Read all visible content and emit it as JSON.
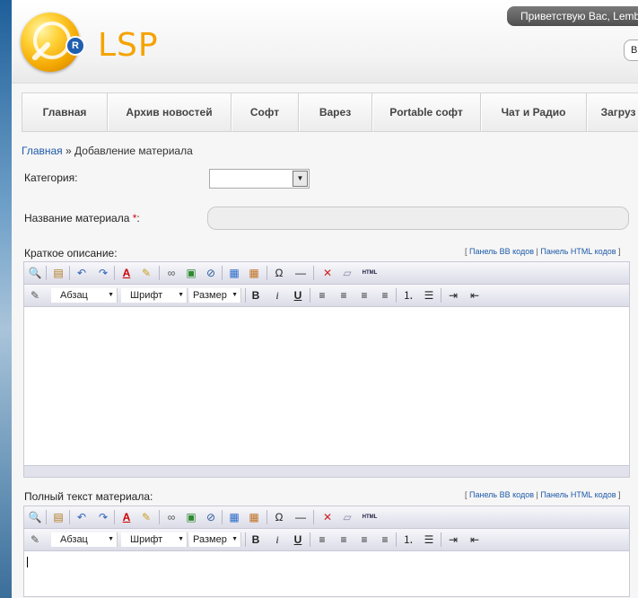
{
  "header": {
    "logo_text": "LSP",
    "logo_badge": "R",
    "welcome": "Приветствую Вас, Lemb",
    "header_button": "В"
  },
  "nav": {
    "items": [
      {
        "label": "Главная"
      },
      {
        "label": "Архив новостей"
      },
      {
        "label": "Софт"
      },
      {
        "label": "Варез"
      },
      {
        "label": "Portable софт"
      },
      {
        "label": "Чат и Радио"
      },
      {
        "label": "Загруз"
      }
    ]
  },
  "breadcrumb": {
    "home": "Главная",
    "sep": " » ",
    "current": "Добавление материала"
  },
  "form": {
    "category_label": "Категория:",
    "category_value": "",
    "title_label": "Название материала ",
    "title_required": "*",
    "title_colon": ":",
    "short_label": "Краткое описание:",
    "full_label": "Полный текст материала:",
    "panels": {
      "open": "[ ",
      "bb": "Панель BB кодов",
      "sep": " | ",
      "html": "Панель HTML кодов",
      "close": " ]"
    }
  },
  "toolbar": {
    "paragraph": "Абзац",
    "font": "Шрифт",
    "size": "Размер",
    "bold": "B",
    "italic": "i",
    "underline": "U",
    "omega": "Ω",
    "html_badge": "HTML"
  },
  "colors": {
    "accent": "#f4a300",
    "link": "#1e5aa8",
    "welcome_bg": "#5a5a5a"
  }
}
